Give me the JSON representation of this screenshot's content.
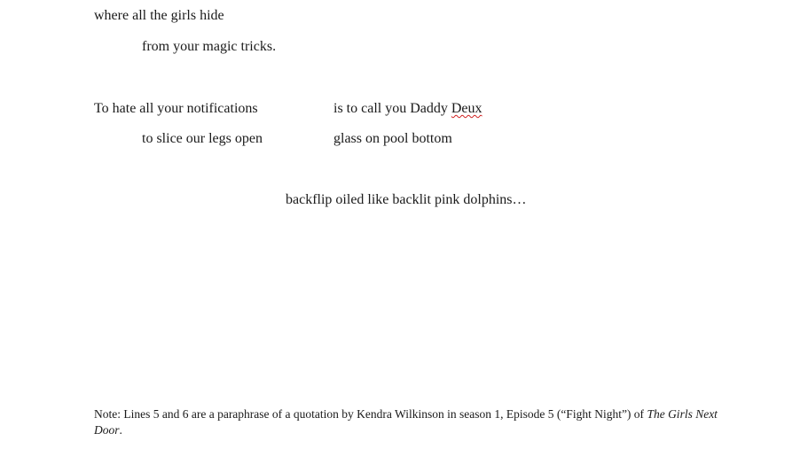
{
  "poem": {
    "line1": "where all the girls hide",
    "line2": "from your magic tricks.",
    "line3_left": "To hate all your notifications",
    "line3_right_prefix": "is to call you Daddy ",
    "line3_right_flagged": "Deux",
    "line4_left": "to slice our legs open",
    "line4_right": "glass on pool bottom",
    "line5": "backflip oiled like backlit pink dolphins…"
  },
  "note": {
    "text": "Note: Lines 5 and 6 are a paraphrase of a quotation by Kendra Wilkinson in season 1, Episode 5 (“Fight Night”) of ",
    "title_italic": "The Girls Next Door",
    "end": "."
  },
  "colors": {
    "spellcheck_underline": "#d02020"
  }
}
